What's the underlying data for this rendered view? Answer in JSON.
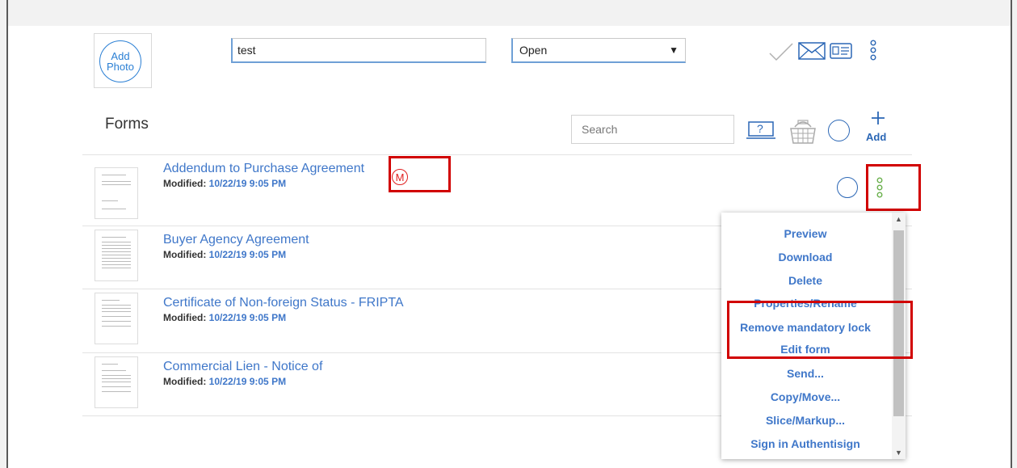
{
  "header": {
    "add_photo_line1": "Add",
    "add_photo_line2": "Photo",
    "name_value": "test",
    "status_value": "Open"
  },
  "forms_section": {
    "title": "Forms",
    "search_placeholder": "Search",
    "help_label": "?",
    "add_label": "Add"
  },
  "forms": [
    {
      "title": "Addendum to Purchase Agreement",
      "modified_label": "Modified:",
      "modified": "10/22/19 9:05 PM",
      "mandatory_badge": "M"
    },
    {
      "title": "Buyer Agency Agreement",
      "modified_label": "Modified:",
      "modified": "10/22/19 9:05 PM"
    },
    {
      "title": "Certificate of Non-foreign Status - FRIPTA",
      "modified_label": "Modified:",
      "modified": "10/22/19 9:05 PM"
    },
    {
      "title": "Commercial Lien - Notice of",
      "modified_label": "Modified:",
      "modified": "10/22/19 9:05 PM"
    }
  ],
  "context_menu": {
    "items": [
      "Preview",
      "Download",
      "Delete",
      "Properties/Rename",
      "Remove mandatory lock",
      "Edit form",
      "Send...",
      "Copy/Move...",
      "Slice/Markup...",
      "Sign in Authentisign"
    ]
  },
  "colors": {
    "accent": "#3f77c9",
    "highlight": "#d10000",
    "menu_dots": "#6ab04c"
  }
}
